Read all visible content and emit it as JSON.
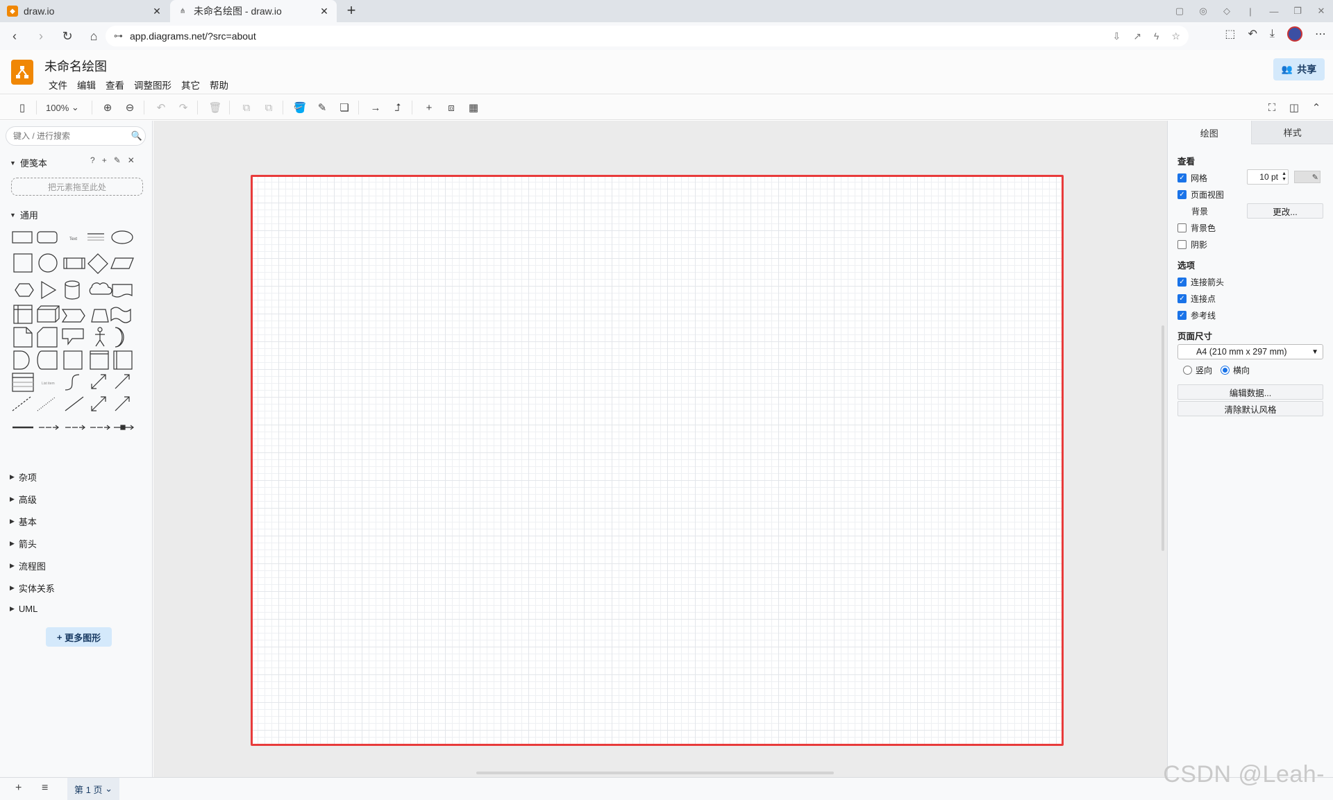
{
  "browser": {
    "tabs": [
      {
        "title": "draw.io"
      },
      {
        "title": "未命名绘图 - draw.io"
      }
    ],
    "url": "app.diagrams.net/?src=about"
  },
  "app": {
    "title": "未命名绘图",
    "menus": [
      "文件",
      "编辑",
      "查看",
      "调整图形",
      "其它",
      "帮助"
    ],
    "share_label": "共享"
  },
  "toolbar": {
    "zoom": "100%"
  },
  "sidebar": {
    "search_placeholder": "键入 / 进行搜索",
    "scratchpad_title": "便笺本",
    "dropzone_text": "把元素拖至此处",
    "general_title": "通用",
    "sections": [
      "杂项",
      "高级",
      "基本",
      "箭头",
      "流程图",
      "实体关系",
      "UML"
    ],
    "more_shapes": "更多图形"
  },
  "right_panel": {
    "tabs": [
      "绘图",
      "样式"
    ],
    "view_title": "查看",
    "grid_label": "网格",
    "grid_checked": true,
    "grid_size": "10 pt",
    "page_view_label": "页面视图",
    "page_view_checked": true,
    "background_label": "背景",
    "background_button": "更改...",
    "bg_color_label": "背景色",
    "bg_color_checked": false,
    "shadow_label": "阴影",
    "shadow_checked": false,
    "options_title": "选项",
    "connection_arrows_label": "连接箭头",
    "connection_points_label": "连接点",
    "guides_label": "参考线",
    "page_size_title": "页面尺寸",
    "page_size_value": "A4 (210 mm x 297 mm)",
    "portrait_label": "竖向",
    "landscape_label": "横向",
    "orientation": "landscape",
    "edit_data_button": "编辑数据...",
    "clear_style_button": "清除默认风格"
  },
  "pagebar": {
    "page_tab": "第 1 页"
  },
  "watermark": "CSDN @Leah-",
  "colors": {
    "accent": "#f08705",
    "highlight": "#e83b3b",
    "checkbox": "#1a73e8"
  }
}
